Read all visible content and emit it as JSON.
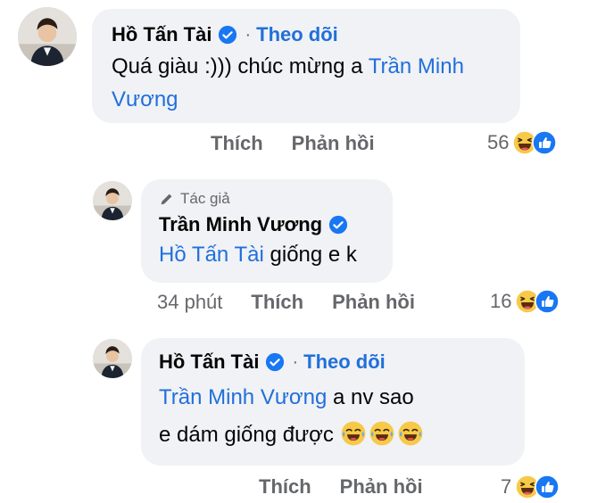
{
  "comments": [
    {
      "author": "Hồ Tấn Tài",
      "separator": "·",
      "follow_label": "Theo dõi",
      "text": "Quá giàu :))) chúc mừng a ",
      "mention": "Trần Minh Vương",
      "actions": {
        "like": "Thích",
        "reply": "Phản hồi"
      },
      "reaction_count": "56"
    },
    {
      "author_tag": "Tác giả",
      "author": "Trần Minh Vương",
      "mention": "Hồ Tấn Tài",
      "text": " giống e k",
      "actions": {
        "time": "34 phút",
        "like": "Thích",
        "reply": "Phản hồi"
      },
      "reaction_count": "16"
    },
    {
      "author": "Hồ Tấn Tài",
      "separator": "·",
      "follow_label": "Theo dõi",
      "mention": "Trần Minh Vương",
      "text": " a nv sao e dám giống được ",
      "actions": {
        "like": "Thích",
        "reply": "Phản hồi"
      },
      "reaction_count": "7"
    }
  ],
  "icons": {
    "verified": "verified-badge-icon",
    "pencil": "pencil-icon",
    "haha": "haha-emoji-icon",
    "like": "like-thumb-icon"
  },
  "colors": {
    "bubble": "#f0f2f5",
    "link": "#216fdb",
    "muted": "#65676b",
    "verified": "#1877f2"
  }
}
